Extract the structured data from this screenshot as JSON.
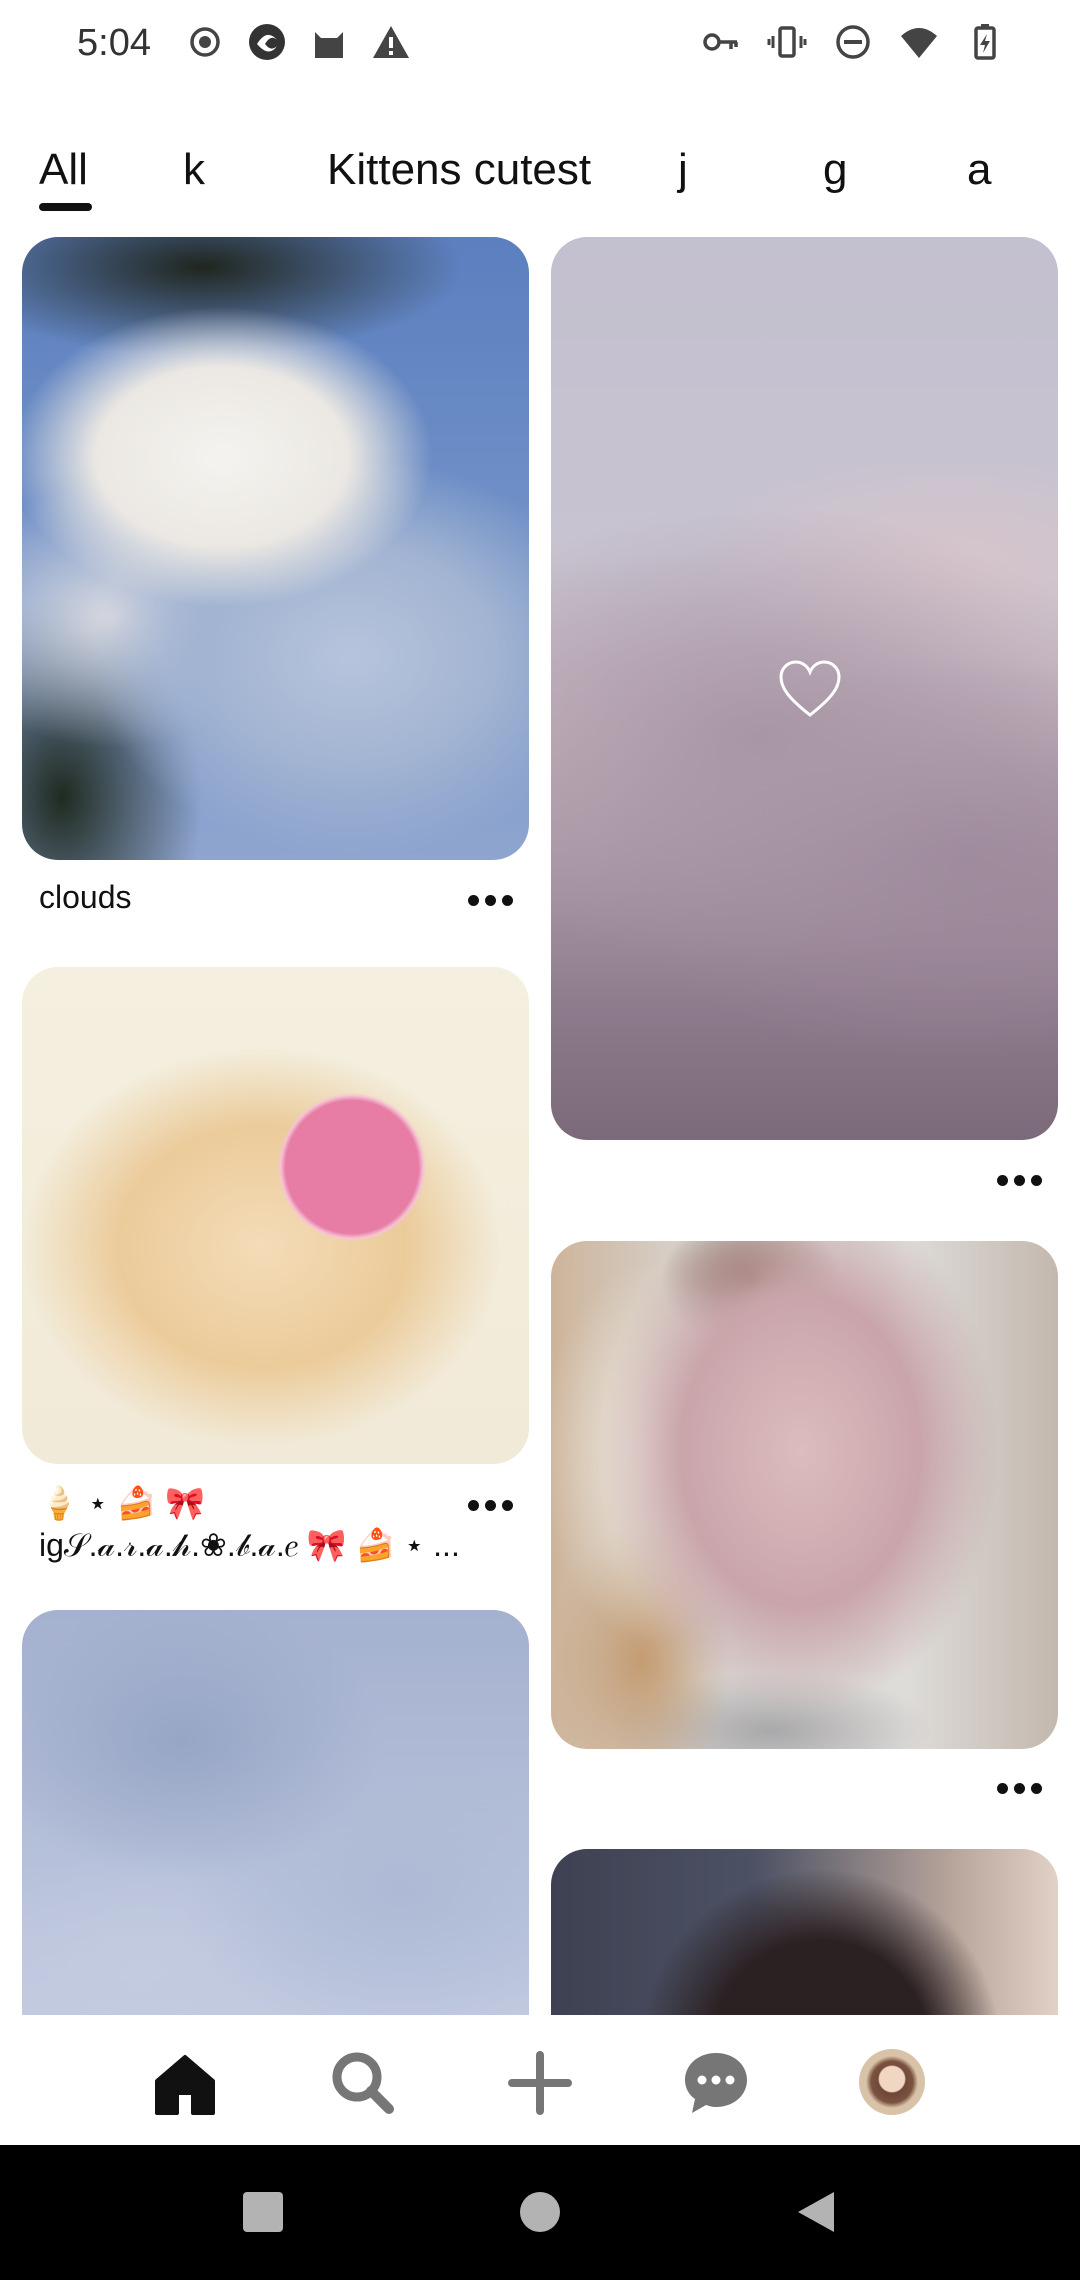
{
  "status_bar": {
    "time": "5:04",
    "left_icons": [
      "record-icon",
      "app-icon",
      "cat-icon",
      "warning-icon"
    ],
    "right_icons": [
      "vpn-key-icon",
      "vibrate-icon",
      "do-not-disturb-icon",
      "wifi-icon",
      "battery-charging-icon"
    ]
  },
  "tabs": [
    {
      "label": "All",
      "active": true
    },
    {
      "label": "k",
      "active": false
    },
    {
      "label": "Kittens cutest",
      "active": false
    },
    {
      "label": "j",
      "active": false
    },
    {
      "label": "g",
      "active": false
    },
    {
      "label": "a",
      "active": false
    }
  ],
  "pins": {
    "left": [
      {
        "title": "clouds",
        "image": "blue sky with clouds and tree branches"
      },
      {
        "title_line1": "🍦 ⋆ 🍰 🎀",
        "title_line2": "ig𝒮.𝒶.𝓇.𝒶.𝒽.❀.𝒷.𝒶.𝑒 🎀 🍰 ⋆ ...",
        "image": "cute cat illustration with fragile sticker"
      },
      {
        "title": "",
        "image": "blue watercolor texture"
      }
    ],
    "right": [
      {
        "title": "",
        "image": "pink purple sky clouds with heart",
        "overlay_icon": "heart-icon"
      },
      {
        "title": "",
        "image": "girl in pink knit sweater"
      },
      {
        "title": "",
        "image": "anime girl portrait"
      }
    ]
  },
  "bottom_nav": [
    {
      "name": "home-icon",
      "active": true
    },
    {
      "name": "search-icon",
      "active": false
    },
    {
      "name": "create-plus-icon",
      "active": false
    },
    {
      "name": "messages-icon",
      "active": false
    },
    {
      "name": "profile-avatar",
      "active": false
    }
  ],
  "system_nav": [
    "recents-square-icon",
    "home-circle-icon",
    "back-triangle-icon"
  ]
}
